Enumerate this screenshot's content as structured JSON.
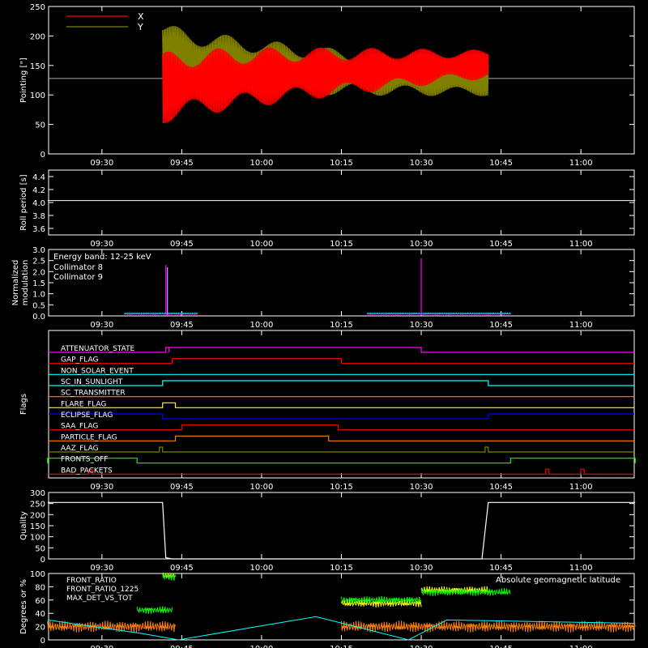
{
  "chart_data": [
    {
      "type": "line",
      "ylabel": "Pointing [\"]",
      "ylim": [
        0,
        250
      ],
      "yticks": [
        0,
        50,
        100,
        150,
        200,
        250
      ],
      "xticks": [
        "09:30",
        "09:45",
        "10:00",
        "10:15",
        "10:30",
        "10:45",
        "11:00"
      ],
      "legend": "top-left",
      "series": [
        {
          "name": "X",
          "color": "#ff0000",
          "segments": [
            {
              "t": [
                9.69,
                10.71
              ],
              "center": [
                110,
                152
              ],
              "amplitude": [
                45,
                18
              ]
            }
          ]
        },
        {
          "name": "Y",
          "color": "#808000",
          "segments": [
            {
              "t": [
                9.69,
                10.71
              ],
              "center": [
                170,
                125
              ],
              "amplitude": [
                40,
                20
              ]
            }
          ]
        }
      ],
      "reference_line": 128
    },
    {
      "type": "line",
      "ylabel": "Roll period [s]",
      "ylim": [
        3.5,
        4.5
      ],
      "yticks": [
        3.6,
        3.8,
        4.0,
        4.2,
        4.4
      ],
      "ytick_labels": [
        "3.6",
        "3.8",
        "4.0",
        "4.2",
        "4.4"
      ],
      "xticks": [
        "09:30",
        "09:45",
        "10:00",
        "10:15",
        "10:30",
        "10:45",
        "11:00"
      ],
      "series": [
        {
          "color": "#ffffff",
          "x": [
            9.33,
            11.17
          ],
          "y": [
            4.03,
            4.03
          ]
        }
      ]
    },
    {
      "type": "line",
      "ylabel": "Normalized modulation",
      "ylabel_lines": [
        "Normalized",
        "modulation"
      ],
      "ylim": [
        0,
        3
      ],
      "yticks": [
        0.0,
        0.5,
        1.0,
        1.5,
        2.0,
        2.5,
        3.0
      ],
      "ytick_labels": [
        "0.0",
        "0.5",
        "1.0",
        "1.5",
        "2.0",
        "2.5",
        "3.0"
      ],
      "xticks": [
        "09:30",
        "09:45",
        "10:00",
        "10:15",
        "10:30",
        "10:45",
        "11:00"
      ],
      "annotation": "Energy band: 12-25 keV",
      "legend": "top-left",
      "series": [
        {
          "name": "Collimator 8",
          "color": "#00ffff",
          "segments": [
            [
              9.57,
              9.8
            ],
            [
              10.33,
              10.78
            ]
          ],
          "level": 0.08
        },
        {
          "name": "Collimator 9",
          "color": "#ff00ff",
          "segments": [
            [
              9.57,
              9.8
            ],
            [
              10.33,
              10.78
            ]
          ],
          "level": 0.05,
          "spikes": [
            [
              9.7,
              2.3
            ],
            [
              10.5,
              2.6
            ]
          ]
        }
      ]
    },
    {
      "type": "line",
      "ylabel": "Flags",
      "xticks": [
        "09:30",
        "09:45",
        "10:00",
        "10:15",
        "10:30",
        "10:45",
        "11:00"
      ],
      "flags": [
        {
          "name": "ATTENUATOR_STATE",
          "color": "#ff00ff",
          "highs": [
            [
              9.7,
              9.71
            ],
            [
              9.71,
              10.5
            ]
          ]
        },
        {
          "name": "GAP_FLAG",
          "color": "#ff0000",
          "highs": [
            [
              9.72,
              10.25
            ]
          ]
        },
        {
          "name": "NON_SOLAR_EVENT",
          "color": "#00ffff",
          "highs": []
        },
        {
          "name": "SC_IN_SUNLIGHT",
          "color": "#00ffff",
          "highs": [
            [
              9.69,
              10.71
            ]
          ]
        },
        {
          "name": "SC_TRANSMITTER",
          "color": "#ff8000",
          "highs": []
        },
        {
          "name": "FLARE_FLAG",
          "color": "#ffff00",
          "highs": [
            [
              9.69,
              9.73
            ]
          ]
        },
        {
          "name": "ECLIPSE_FLAG",
          "color": "#0000ff",
          "highs": [
            [
              9.69,
              10.71
            ]
          ],
          "invert": true
        },
        {
          "name": "SAA_FLAG",
          "color": "#ff0000",
          "highs": [
            [
              9.75,
              10.24
            ]
          ]
        },
        {
          "name": "PARTICLE_FLAG",
          "color": "#ff8000",
          "highs": [
            [
              9.73,
              10.21
            ]
          ]
        },
        {
          "name": "AAZ_FLAG",
          "color": "#808000",
          "highs": [
            [
              9.68,
              9.69
            ],
            [
              10.7,
              10.71
            ]
          ]
        },
        {
          "name": "FRONTS_OFF",
          "color": "#00ff00",
          "highs": [
            [
              9.33,
              9.61
            ],
            [
              10.78,
              11.17
            ]
          ]
        },
        {
          "name": "BAD_PACKETS",
          "color": "#ff0000",
          "highs": [
            [
              9.46,
              9.47
            ],
            [
              11.0,
              11.01
            ],
            [
              10.89,
              10.9
            ]
          ]
        }
      ]
    },
    {
      "type": "line",
      "ylabel": "Quality",
      "ylim": [
        0,
        300
      ],
      "yticks": [
        0,
        50,
        100,
        150,
        200,
        250,
        300
      ],
      "xticks": [
        "09:30",
        "09:45",
        "10:00",
        "10:15",
        "10:30",
        "10:45",
        "11:00"
      ],
      "series": [
        {
          "color": "#ffffff",
          "x": [
            9.33,
            9.69,
            9.7,
            9.72,
            10.69,
            10.71,
            11.17
          ],
          "y": [
            255,
            255,
            5,
            0,
            0,
            255,
            255
          ]
        }
      ]
    },
    {
      "type": "line",
      "ylabel": "Degrees or %",
      "ylim": [
        0,
        100
      ],
      "yticks": [
        0,
        20,
        40,
        60,
        80,
        100
      ],
      "xticks": [
        "09:30",
        "09:45",
        "10:00",
        "10:15",
        "10:30",
        "10:45",
        "11:00"
      ],
      "legend": "top-left",
      "annotation": "Absolute geomagnetic latitude",
      "series": [
        {
          "name": "FRONT_RATIO",
          "color": "#ffff00",
          "segments": [
            [
              9.69,
              9.73,
              97
            ],
            [
              10.25,
              10.5,
              55
            ],
            [
              10.5,
              10.71,
              75
            ]
          ]
        },
        {
          "name": "FRONT_RATIO_1225",
          "color": "#00ff00",
          "segments": [
            [
              9.61,
              9.72,
              45
            ],
            [
              9.69,
              9.73,
              95
            ],
            [
              10.25,
              10.5,
              60
            ],
            [
              10.5,
              10.78,
              72
            ]
          ]
        },
        {
          "name": "MAX_DET_VS_TOT",
          "color": "#ff8000",
          "segments": [
            [
              9.33,
              9.73,
              20
            ],
            [
              10.25,
              11.17,
              20
            ]
          ]
        },
        {
          "name": "Absolute geomagnetic latitude",
          "color": "#00ffff",
          "x": [
            9.33,
            9.62,
            9.74,
            10.17,
            10.46,
            10.58,
            11.17
          ],
          "y": [
            30,
            10,
            0,
            35,
            0,
            30,
            25
          ]
        }
      ]
    }
  ]
}
